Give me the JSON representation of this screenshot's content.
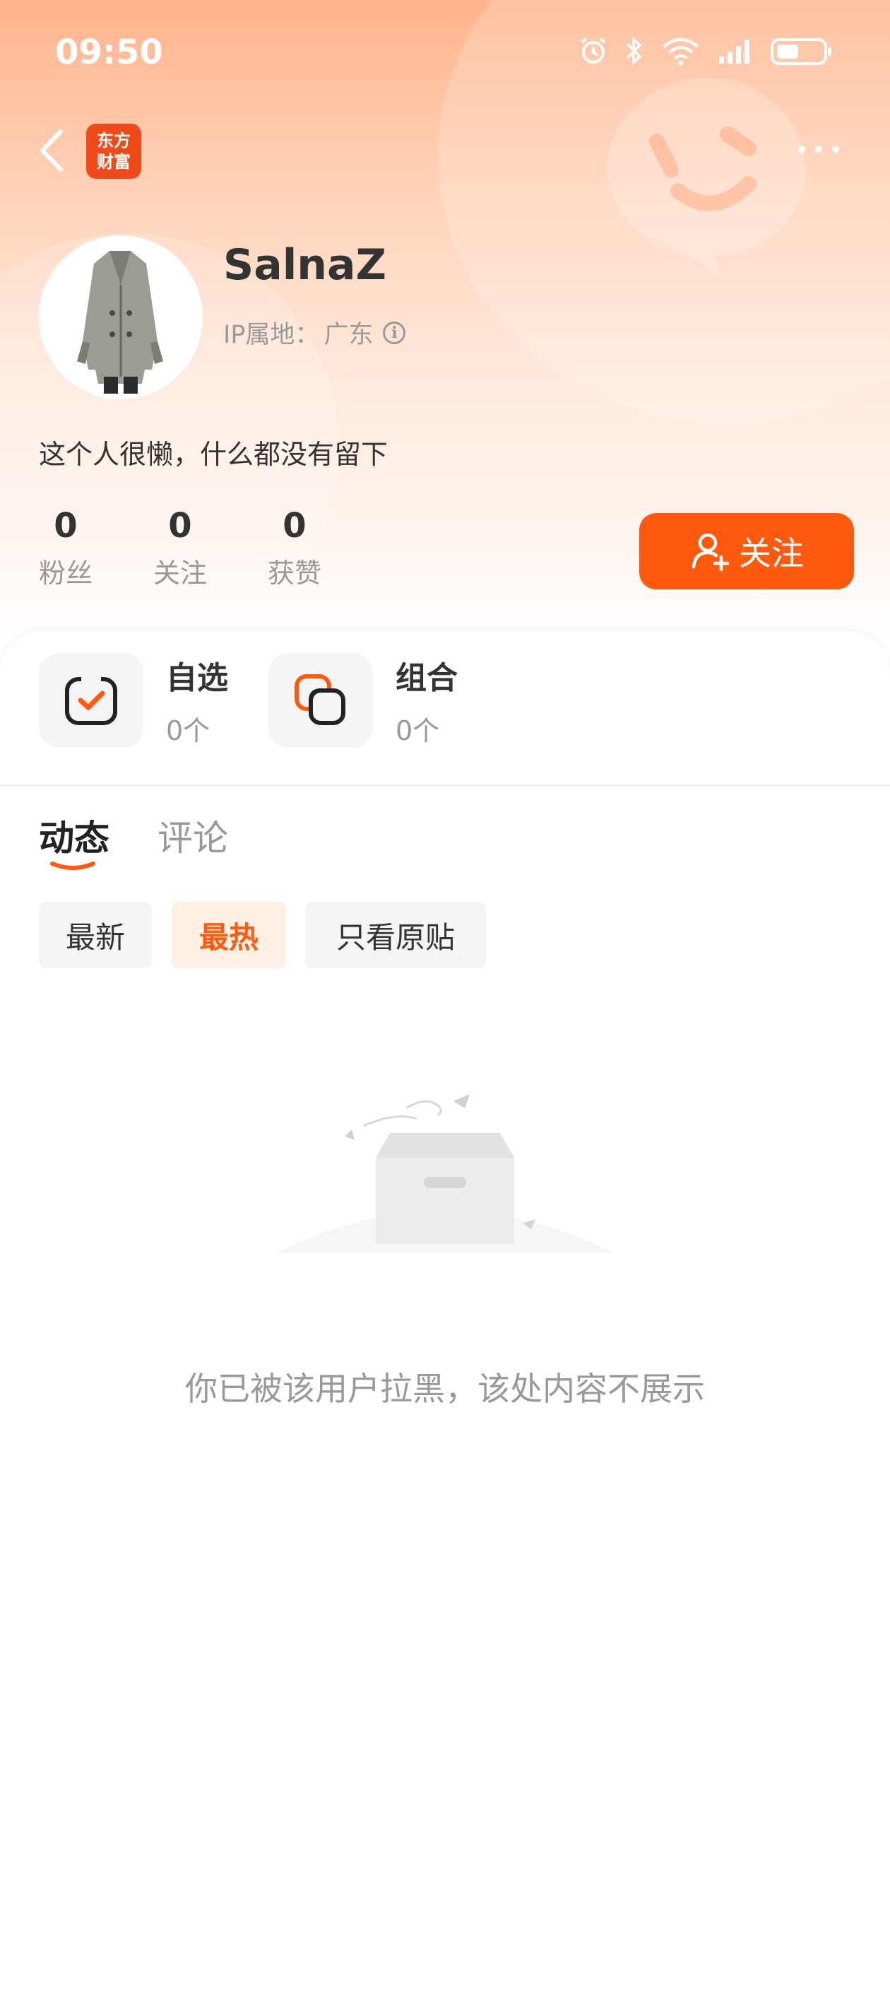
{
  "status_bar": {
    "time": "09:50",
    "icons": [
      "alarm-icon",
      "bluetooth-icon",
      "wifi-icon",
      "signal-icon",
      "battery-icon"
    ]
  },
  "nav": {
    "logo_line1": "东方",
    "logo_line2": "财富"
  },
  "profile": {
    "username": "SalnaZ",
    "ip_label": "IP属地：",
    "ip_location": "广东",
    "bio": "这个人很懒，什么都没有留下",
    "stats": [
      {
        "num": "0",
        "label": "粉丝"
      },
      {
        "num": "0",
        "label": "关注"
      },
      {
        "num": "0",
        "label": "获赞"
      }
    ],
    "follow_label": "关注"
  },
  "quick_entries": [
    {
      "title": "自选",
      "count": "0个"
    },
    {
      "title": "组合",
      "count": "0个"
    }
  ],
  "tabs": [
    {
      "label": "动态",
      "active": true
    },
    {
      "label": "评论",
      "active": false
    }
  ],
  "filters": [
    {
      "label": "最新",
      "active": false
    },
    {
      "label": "最热",
      "active": true
    },
    {
      "label": "只看原贴",
      "active": false
    }
  ],
  "empty_message": "你已被该用户拉黑，该处内容不展示",
  "colors": {
    "accent": "#ff5a0d",
    "logo_bg": "#ef4a1a",
    "header_top": "#ffb48c"
  }
}
